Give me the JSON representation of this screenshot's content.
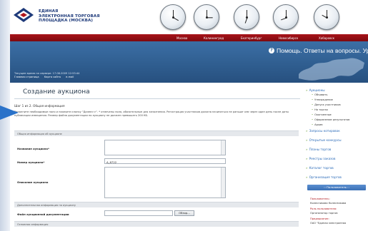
{
  "brand": {
    "line1": "ЕДИНАЯ",
    "line2": "ЭЛЕКТРОННАЯ ТОРГОВАЯ",
    "line3": "ПЛОЩАДКА (МОСКВА)"
  },
  "cities": [
    "Москва",
    "Калининград",
    "Екатеринбург",
    "Новосибирск",
    "Хабаровск"
  ],
  "help": {
    "text": "Помощь. Ответы на вопросы. Ур"
  },
  "info": {
    "server_time": "Текущее время на сервере: 17.08.2009 12:53:44",
    "nav": [
      "Главная страница",
      "Карта сайта",
      "e-mail"
    ]
  },
  "main": {
    "title": "Создание аукциона",
    "step": "Шаг 1 из 2. Общая информация",
    "notice": "Заполните необходимые поля и нажмите кнопку \"Далее>>\". * отмечены поля, обязательные для заполнения. Регистрация участников должна начинаться не раньше чем через один день после даты публикации извещения. Размер файла документации по аукциону не должен превышать 200 КБ.",
    "section_general": "Общая информация об аукционе",
    "label_name": "Название аукциона*",
    "label_number": "Номер аукциона*",
    "number_value": "А_6722",
    "label_description": "Описание аукциона",
    "section_extra": "Дополнительная информация по аукциону",
    "label_file": "Файл аукционной документации",
    "browse_label": "Обзор...",
    "section_basic": "Основная информация"
  },
  "sidebar": {
    "auctions": "Аукционы",
    "auction_items": [
      "Объявить",
      "Утверждение",
      "Допуск участников",
      "На торгах",
      "Оконченные",
      "Оформление результатов",
      "Архив"
    ],
    "links": [
      "Запросы котировок",
      "Открытые конкурсы",
      "Планы торгов",
      "Реестры заказов",
      "Каталог торгов",
      "Организация торгов"
    ],
    "button": ":: Пользователь ::",
    "user_label": "Пользователь:",
    "user_value": "Колесникова Колесникова",
    "role_label": "Роль пользователя:",
    "role_value": "Организатор торгов",
    "company_label": "Предприятие:",
    "company_value": "ОАО \"Единая электронная"
  },
  "colors": {
    "accent_red": "#a8141a",
    "accent_blue": "#2f5d8f",
    "link_blue": "#2a6ab8",
    "pointer_blue": "#2a72c9"
  }
}
